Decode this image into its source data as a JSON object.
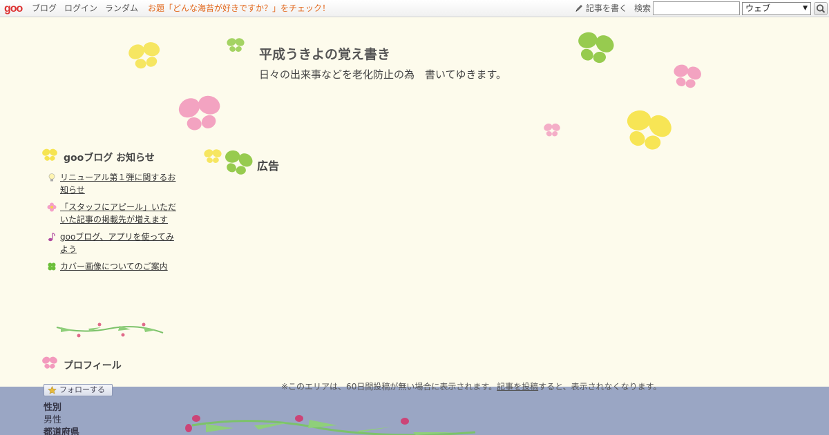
{
  "topbar": {
    "logo": "goo",
    "nav_blog": "ブログ",
    "nav_login": "ログイン",
    "nav_random": "ランダム",
    "topic": "お題「どんな海苔が好きですか？」をチェック！",
    "write_label": "記事を書く",
    "search_label": "検索",
    "search_value": "",
    "search_scope": "ウェブ"
  },
  "header": {
    "title": "平成うきよの覚え書き",
    "description": "日々の出来事などを老化防止の為　書いてゆきます。"
  },
  "sidebar": {
    "notice_heading": "gooブログ お知らせ",
    "notices": [
      {
        "text": "リニューアル第１弾に関するお知らせ",
        "icon": "lightbulb-icon"
      },
      {
        "text": "「スタッフにアピール」いただいた記事の掲載先が増えます",
        "icon": "flower-icon"
      },
      {
        "text": "gooブログ、アプリを使ってみよう",
        "icon": "music-note-icon"
      },
      {
        "text": "カバー画像についてのご案内",
        "icon": "clover-icon"
      }
    ],
    "profile_heading": "プロフィール",
    "follow_label": "フォローする",
    "profile": {
      "gender_label": "性別",
      "gender_value": "男性",
      "prefecture_label": "都道府県"
    }
  },
  "main": {
    "ad_heading": "広告",
    "notice_before": "※このエリアは、60日間投稿が無い場合に表示されます。",
    "notice_link": "記事を投稿",
    "notice_after": "すると、表示されなくなります。"
  },
  "colors": {
    "background": "#fdfbec",
    "footer_band": "#9aa6c4",
    "topic_link": "#e2681d",
    "logo": "#dd3333"
  }
}
